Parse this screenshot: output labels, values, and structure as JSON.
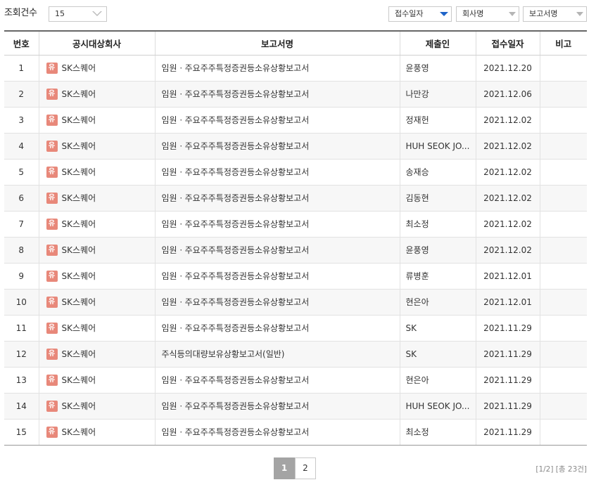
{
  "toolbar": {
    "count_label": "조회건수",
    "count_value": "15",
    "sort_receipt_date": "접수일자",
    "sort_company": "회사명",
    "sort_report": "보고서명"
  },
  "table": {
    "headers": [
      "번호",
      "공시대상회사",
      "보고서명",
      "제출인",
      "접수일자",
      "비고"
    ],
    "rows": [
      {
        "num": "1",
        "badge": "유",
        "company": "SK스퀘어",
        "report": "임원ㆍ주요주주특정증권등소유상황보고서",
        "submitter": "윤풍영",
        "date": "2021.12.20",
        "note": ""
      },
      {
        "num": "2",
        "badge": "유",
        "company": "SK스퀘어",
        "report": "임원ㆍ주요주주특정증권등소유상황보고서",
        "submitter": "나만강",
        "date": "2021.12.06",
        "note": ""
      },
      {
        "num": "3",
        "badge": "유",
        "company": "SK스퀘어",
        "report": "임원ㆍ주요주주특정증권등소유상황보고서",
        "submitter": "정재헌",
        "date": "2021.12.02",
        "note": ""
      },
      {
        "num": "4",
        "badge": "유",
        "company": "SK스퀘어",
        "report": "임원ㆍ주요주주특정증권등소유상황보고서",
        "submitter": "HUH SEOK JO...",
        "date": "2021.12.02",
        "note": ""
      },
      {
        "num": "5",
        "badge": "유",
        "company": "SK스퀘어",
        "report": "임원ㆍ주요주주특정증권등소유상황보고서",
        "submitter": "송재승",
        "date": "2021.12.02",
        "note": ""
      },
      {
        "num": "6",
        "badge": "유",
        "company": "SK스퀘어",
        "report": "임원ㆍ주요주주특정증권등소유상황보고서",
        "submitter": "김동현",
        "date": "2021.12.02",
        "note": ""
      },
      {
        "num": "7",
        "badge": "유",
        "company": "SK스퀘어",
        "report": "임원ㆍ주요주주특정증권등소유상황보고서",
        "submitter": "최소정",
        "date": "2021.12.02",
        "note": ""
      },
      {
        "num": "8",
        "badge": "유",
        "company": "SK스퀘어",
        "report": "임원ㆍ주요주주특정증권등소유상황보고서",
        "submitter": "윤풍영",
        "date": "2021.12.02",
        "note": ""
      },
      {
        "num": "9",
        "badge": "유",
        "company": "SK스퀘어",
        "report": "임원ㆍ주요주주특정증권등소유상황보고서",
        "submitter": "류병훈",
        "date": "2021.12.01",
        "note": ""
      },
      {
        "num": "10",
        "badge": "유",
        "company": "SK스퀘어",
        "report": "임원ㆍ주요주주특정증권등소유상황보고서",
        "submitter": "현은아",
        "date": "2021.12.01",
        "note": ""
      },
      {
        "num": "11",
        "badge": "유",
        "company": "SK스퀘어",
        "report": "임원ㆍ주요주주특정증권등소유상황보고서",
        "submitter": "SK",
        "date": "2021.11.29",
        "note": ""
      },
      {
        "num": "12",
        "badge": "유",
        "company": "SK스퀘어",
        "report": "주식등의대량보유상황보고서(일반)",
        "submitter": "SK",
        "date": "2021.11.29",
        "note": ""
      },
      {
        "num": "13",
        "badge": "유",
        "company": "SK스퀘어",
        "report": "임원ㆍ주요주주특정증권등소유상황보고서",
        "submitter": "현은아",
        "date": "2021.11.29",
        "note": ""
      },
      {
        "num": "14",
        "badge": "유",
        "company": "SK스퀘어",
        "report": "임원ㆍ주요주주특정증권등소유상황보고서",
        "submitter": "HUH SEOK JO...",
        "date": "2021.11.29",
        "note": ""
      },
      {
        "num": "15",
        "badge": "유",
        "company": "SK스퀘어",
        "report": "임원ㆍ주요주주특정증권등소유상황보고서",
        "submitter": "최소정",
        "date": "2021.11.29",
        "note": ""
      }
    ]
  },
  "pagination": {
    "pages": [
      "1",
      "2"
    ],
    "current": "1",
    "info": "[1/2] [총 23건]"
  },
  "colors": {
    "badge": "#e8887a",
    "active_page": "#a4a4a4",
    "sort_arrow_active": "#1f64c8"
  }
}
